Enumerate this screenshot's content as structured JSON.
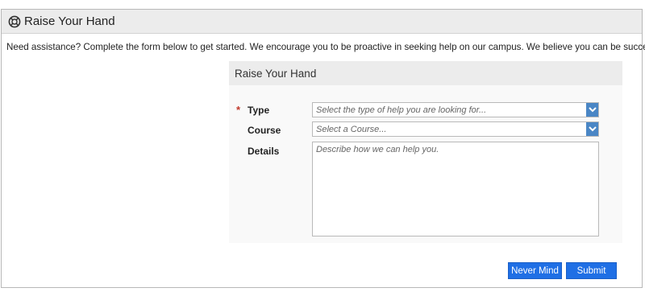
{
  "header": {
    "title": "Raise Your Hand",
    "icon": "lifebuoy-icon"
  },
  "intro": "Need assistance? Complete the form below to get started. We encourage you to be proactive in seeking help on our campus. We believe you can be successful!",
  "form": {
    "title": "Raise Your Hand",
    "required_mark": "*",
    "type": {
      "label": "Type",
      "placeholder": "Select the type of help you are looking for..."
    },
    "course": {
      "label": "Course",
      "placeholder": "Select a Course..."
    },
    "details": {
      "label": "Details",
      "placeholder": "Describe how we can help you."
    }
  },
  "buttons": {
    "cancel": "Never Mind",
    "submit": "Submit"
  },
  "colors": {
    "accent": "#1f6fe5",
    "dropdown": "#4a86c5",
    "required": "#c0392b"
  }
}
